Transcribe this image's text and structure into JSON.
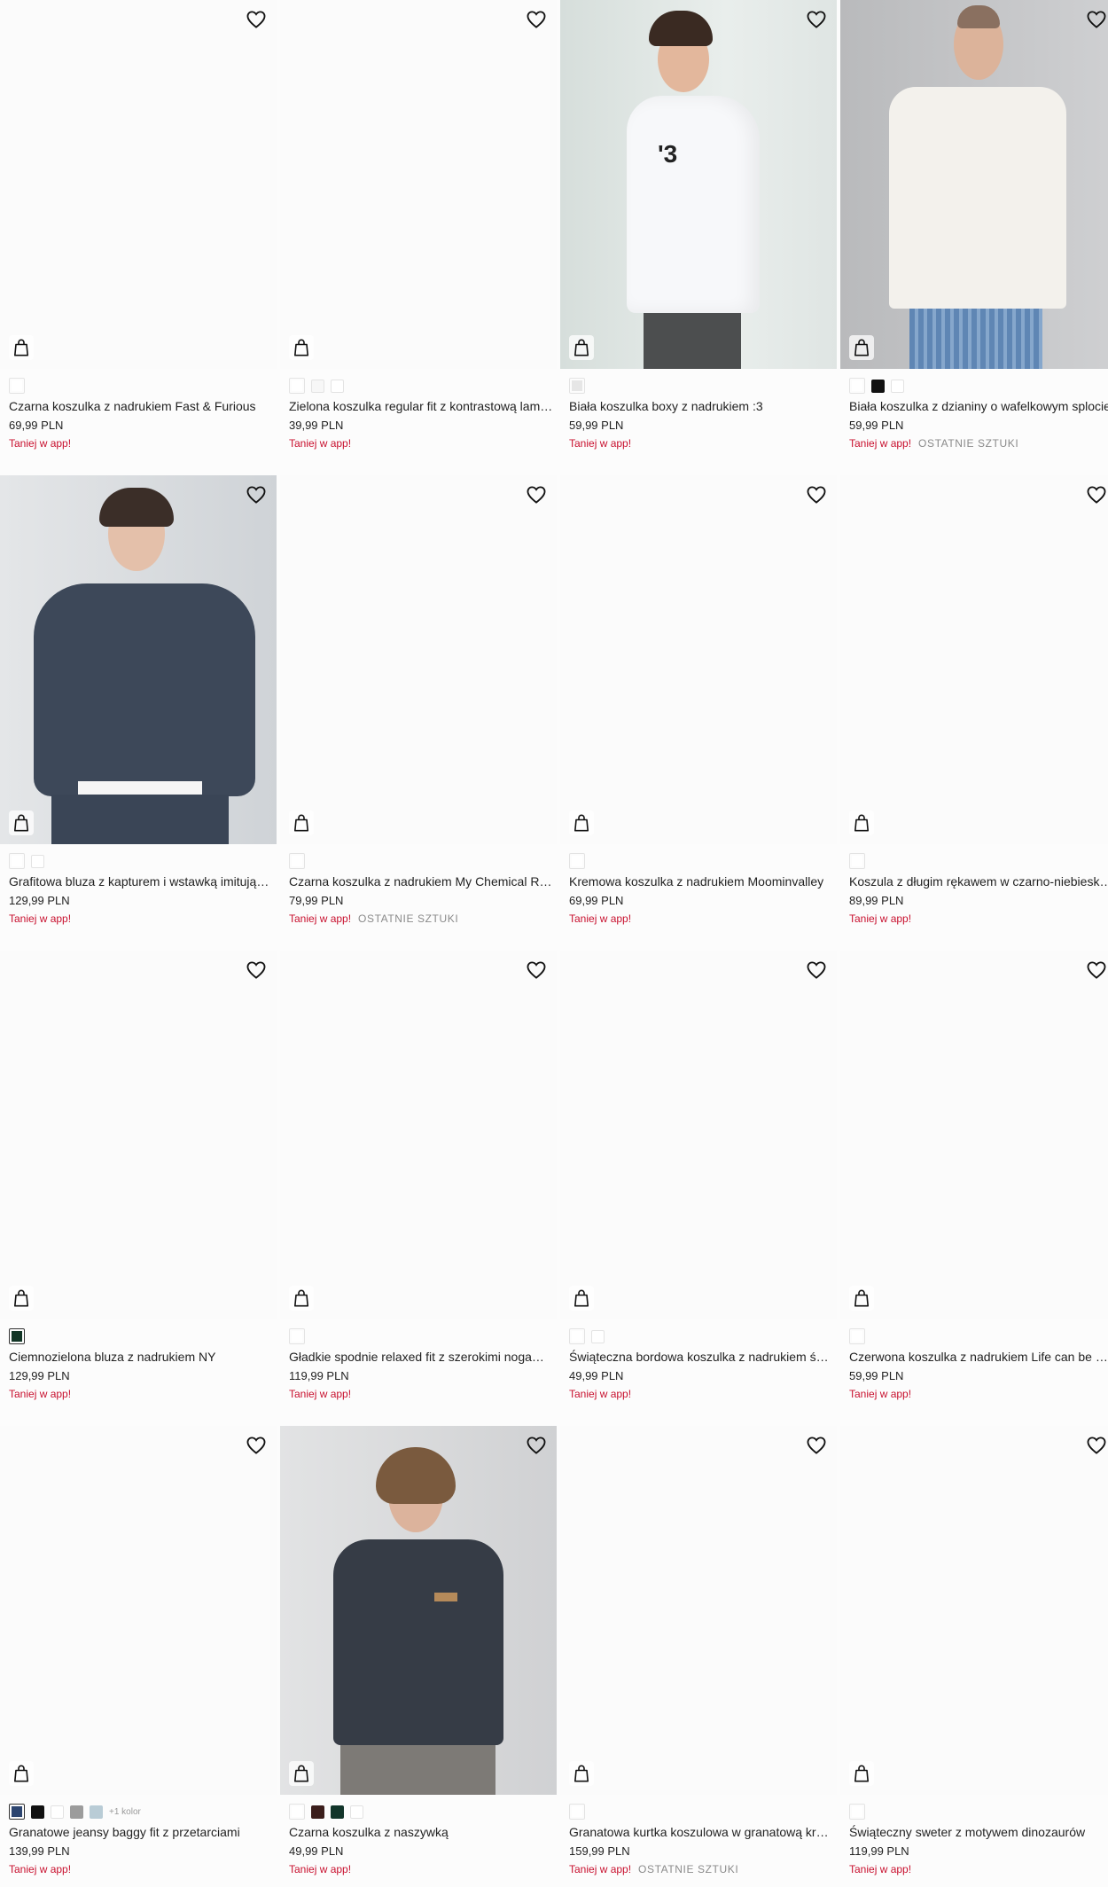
{
  "products": [
    {
      "name": "Czarna koszulka z nadrukiem Fast & Furious",
      "price": "69,99 PLN",
      "promo": "Taniej w app!",
      "badge": "",
      "colors": [
        "#ffffff"
      ],
      "extra_colors": ""
    },
    {
      "name": "Zielona koszulka regular fit z kontrastową lamówką",
      "price": "39,99 PLN",
      "promo": "Taniej w app!",
      "badge": "",
      "colors": [
        "#ffffff",
        "#f7f7f7",
        "#ffffff"
      ],
      "extra_colors": ""
    },
    {
      "name": "Biała koszulka boxy z nadrukiem :3",
      "price": "59,99 PLN",
      "promo": "Taniej w app!",
      "badge": "",
      "colors": [
        "#e6e6e6"
      ],
      "extra_colors": ""
    },
    {
      "name": "Biała koszulka z dzianiny o wafelkowym splocie",
      "price": "59,99 PLN",
      "promo": "Taniej w app!",
      "badge": "OSTATNIE SZTUKI",
      "colors": [
        "#ffffff",
        "#111111",
        "#ffffff"
      ],
      "extra_colors": ""
    },
    {
      "name": "Grafitowa bluza z kapturem i wstawką imitującą koszulkę",
      "price": "129,99 PLN",
      "promo": "Taniej w app!",
      "badge": "",
      "colors": [
        "#ffffff",
        "#ffffff"
      ],
      "extra_colors": ""
    },
    {
      "name": "Czarna koszulka z nadrukiem My Chemical Romance",
      "price": "79,99 PLN",
      "promo": "Taniej w app!",
      "badge": "OSTATNIE SZTUKI",
      "colors": [
        "#ffffff"
      ],
      "extra_colors": ""
    },
    {
      "name": "Kremowa koszulka z nadrukiem Moominvalley",
      "price": "69,99 PLN",
      "promo": "Taniej w app!",
      "badge": "",
      "colors": [
        "#ffffff"
      ],
      "extra_colors": ""
    },
    {
      "name": "Koszula z długim rękawem w czarno-niebieską kratę",
      "price": "89,99 PLN",
      "promo": "Taniej w app!",
      "badge": "",
      "colors": [
        "#ffffff"
      ],
      "extra_colors": ""
    },
    {
      "name": "Ciemnozielona bluza z nadrukiem NY",
      "price": "129,99 PLN",
      "promo": "Taniej w app!",
      "badge": "",
      "colors": [
        "#123526"
      ],
      "extra_colors": ""
    },
    {
      "name": "Gładkie spodnie relaxed fit z szerokimi nogawkami",
      "price": "119,99 PLN",
      "promo": "Taniej w app!",
      "badge": "",
      "colors": [
        "#ffffff"
      ],
      "extra_colors": ""
    },
    {
      "name": "Świąteczna bordowa koszulka z nadrukiem świątecznym",
      "price": "49,99 PLN",
      "promo": "Taniej w app!",
      "badge": "",
      "colors": [
        "#ffffff",
        "#ffffff"
      ],
      "extra_colors": ""
    },
    {
      "name": "Czerwona koszulka z nadrukiem Life can be sweet",
      "price": "59,99 PLN",
      "promo": "Taniej w app!",
      "badge": "",
      "colors": [
        "#ffffff"
      ],
      "extra_colors": ""
    },
    {
      "name": "Granatowe jeansy baggy fit z przetarciami",
      "price": "139,99 PLN",
      "promo": "Taniej w app!",
      "badge": "",
      "colors": [
        "#2d4570",
        "#111111",
        "#ffffff",
        "#9c9c9c",
        "#b9ccd6"
      ],
      "extra_colors": "+1 kolor"
    },
    {
      "name": "Czarna koszulka z naszywką",
      "price": "49,99 PLN",
      "promo": "Taniej w app!",
      "badge": "",
      "colors": [
        "#ffffff",
        "#3b1e1c",
        "#12352a",
        "#ffffff"
      ],
      "extra_colors": ""
    },
    {
      "name": "Granatowa kurtka koszulowa w granatową kratę",
      "price": "159,99 PLN",
      "promo": "Taniej w app!",
      "badge": "OSTATNIE SZTUKI",
      "colors": [
        "#ffffff"
      ],
      "extra_colors": ""
    },
    {
      "name": "Świąteczny sweter z motywem dinozaurów",
      "price": "119,99 PLN",
      "promo": "Taniej w app!",
      "badge": "",
      "colors": [
        "#ffffff"
      ],
      "extra_colors": ""
    }
  ],
  "icons": {
    "favorite": "heart-icon",
    "cart": "shopping-bag-icon"
  }
}
